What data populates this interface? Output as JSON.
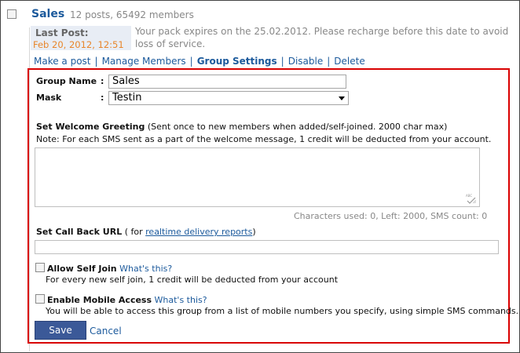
{
  "group": {
    "name": "Sales",
    "summary": "12 posts, 65492 members",
    "last_post_label": "Last Post:",
    "last_post_date": "Feb 20, 2012, 12:51",
    "expiry_notice": "Your pack expires on the 25.02.2012. Please recharge before this date to avoid loss of service."
  },
  "actions": {
    "make_post": "Make a post",
    "manage_members": "Manage Members",
    "group_settings": "Group Settings",
    "disable": "Disable",
    "delete": "Delete",
    "separator": "|"
  },
  "settings": {
    "group_name_label": "Group Name",
    "group_name_value": "Sales",
    "mask_label": "Mask",
    "mask_value": "Testin",
    "colon": ":",
    "welcome_title": "Set Welcome Greeting",
    "welcome_hint": "(Sent once to new members when added/self-joined. 2000 char max)",
    "welcome_note": "Note: For each SMS sent as a part of the welcome message, 1 credit will be deducted from your account.",
    "welcome_value": "",
    "char_counts": "Characters used: 0,  Left: 2000,  SMS count: 0",
    "callback_title": "Set Call Back URL",
    "callback_hint_pre": "( for",
    "callback_link": "realtime delivery reports",
    "callback_hint_post": ")",
    "callback_value": "",
    "allow_self_join": "Allow Self Join",
    "allow_self_join_help": "What's this?",
    "allow_self_join_desc": "For every new self join, 1 credit will be deducted from your account",
    "mobile_access": "Enable Mobile Access",
    "mobile_access_help": "What's this?",
    "mobile_access_desc": "You will be able to access this group from a list of mobile numbers you specify, using simple SMS commands.",
    "save": "Save",
    "cancel": "Cancel"
  },
  "colors": {
    "link": "#1c5a9c",
    "highlight_border": "#d90000",
    "date": "#e8862b",
    "save_button": "#3b5998"
  }
}
